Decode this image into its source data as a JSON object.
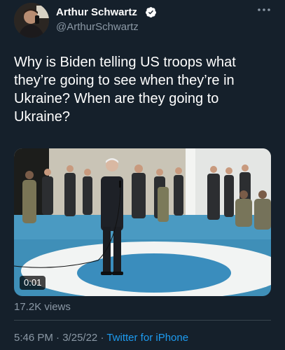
{
  "author": {
    "name": "Arthur Schwartz",
    "handle": "@ArthurSchwartz",
    "verified": true,
    "avatar_icon": "profile-photo"
  },
  "menu": {
    "more_icon": "more-horizontal-icon"
  },
  "tweet": {
    "text": "Why is Biden telling US troops what they’re going to see when they’re in Ukraine? When are they going to Ukraine?"
  },
  "media": {
    "type": "video",
    "duration": "0:01"
  },
  "stats": {
    "views": "17.2K views"
  },
  "meta": {
    "time": "5:46 PM",
    "separator": "·",
    "date": "3/25/22",
    "source": "Twitter for iPhone"
  },
  "colors": {
    "background": "#15202b",
    "text_primary": "#ffffff",
    "text_secondary": "#8b98a5",
    "accent": "#1d9bf0",
    "divider": "#38444d"
  }
}
